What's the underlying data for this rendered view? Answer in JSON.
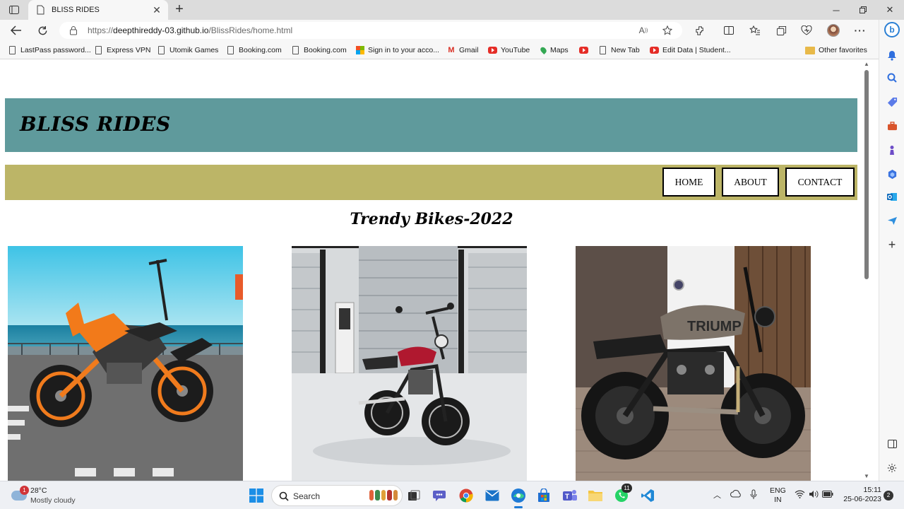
{
  "browser": {
    "tab_title": "BLISS RIDES",
    "url_prefix": "https://",
    "url_domain": "deepthireddy-03.github.io",
    "url_path": "/BlissRides/home.html",
    "favorites": [
      {
        "label": "LastPass password...",
        "icon": "page-icon"
      },
      {
        "label": "Express VPN",
        "icon": "page-icon"
      },
      {
        "label": "Utomik Games",
        "icon": "page-icon"
      },
      {
        "label": "Booking.com",
        "icon": "page-icon"
      },
      {
        "label": "Booking.com",
        "icon": "page-icon"
      },
      {
        "label": "Sign in to your acco...",
        "icon": "microsoft-icon"
      },
      {
        "label": "Gmail",
        "icon": "gmail-icon"
      },
      {
        "label": "YouTube",
        "icon": "youtube-icon"
      },
      {
        "label": "Maps",
        "icon": "maps-icon"
      },
      {
        "label": "",
        "icon": "youtube-icon"
      },
      {
        "label": "New Tab",
        "icon": "page-icon"
      },
      {
        "label": "Edit Data | Student...",
        "icon": "youtube-icon"
      }
    ],
    "other_favorites": "Other favorites"
  },
  "site": {
    "title": "BLISS RIDES",
    "nav": [
      {
        "label": "HOME"
      },
      {
        "label": "ABOUT"
      },
      {
        "label": "CONTACT"
      }
    ],
    "section_title": "Trendy Bikes-2022",
    "bikes": [
      {
        "image": "orange-ktm-duke-photo"
      },
      {
        "image": "red-royal-enfield-photo"
      },
      {
        "image": "triumph-cafe-racer-photo"
      }
    ],
    "colors": {
      "header": "#5f9a9c",
      "nav": "#bcb567"
    }
  },
  "taskbar": {
    "weather_temp": "28°C",
    "weather_desc": "Mostly cloudy",
    "weather_badge": "1",
    "search_label": "Search",
    "whatsapp_badge": "11",
    "lang_line1": "ENG",
    "lang_line2": "IN",
    "time": "15:11",
    "date": "25-06-2023",
    "notifications": "2"
  }
}
